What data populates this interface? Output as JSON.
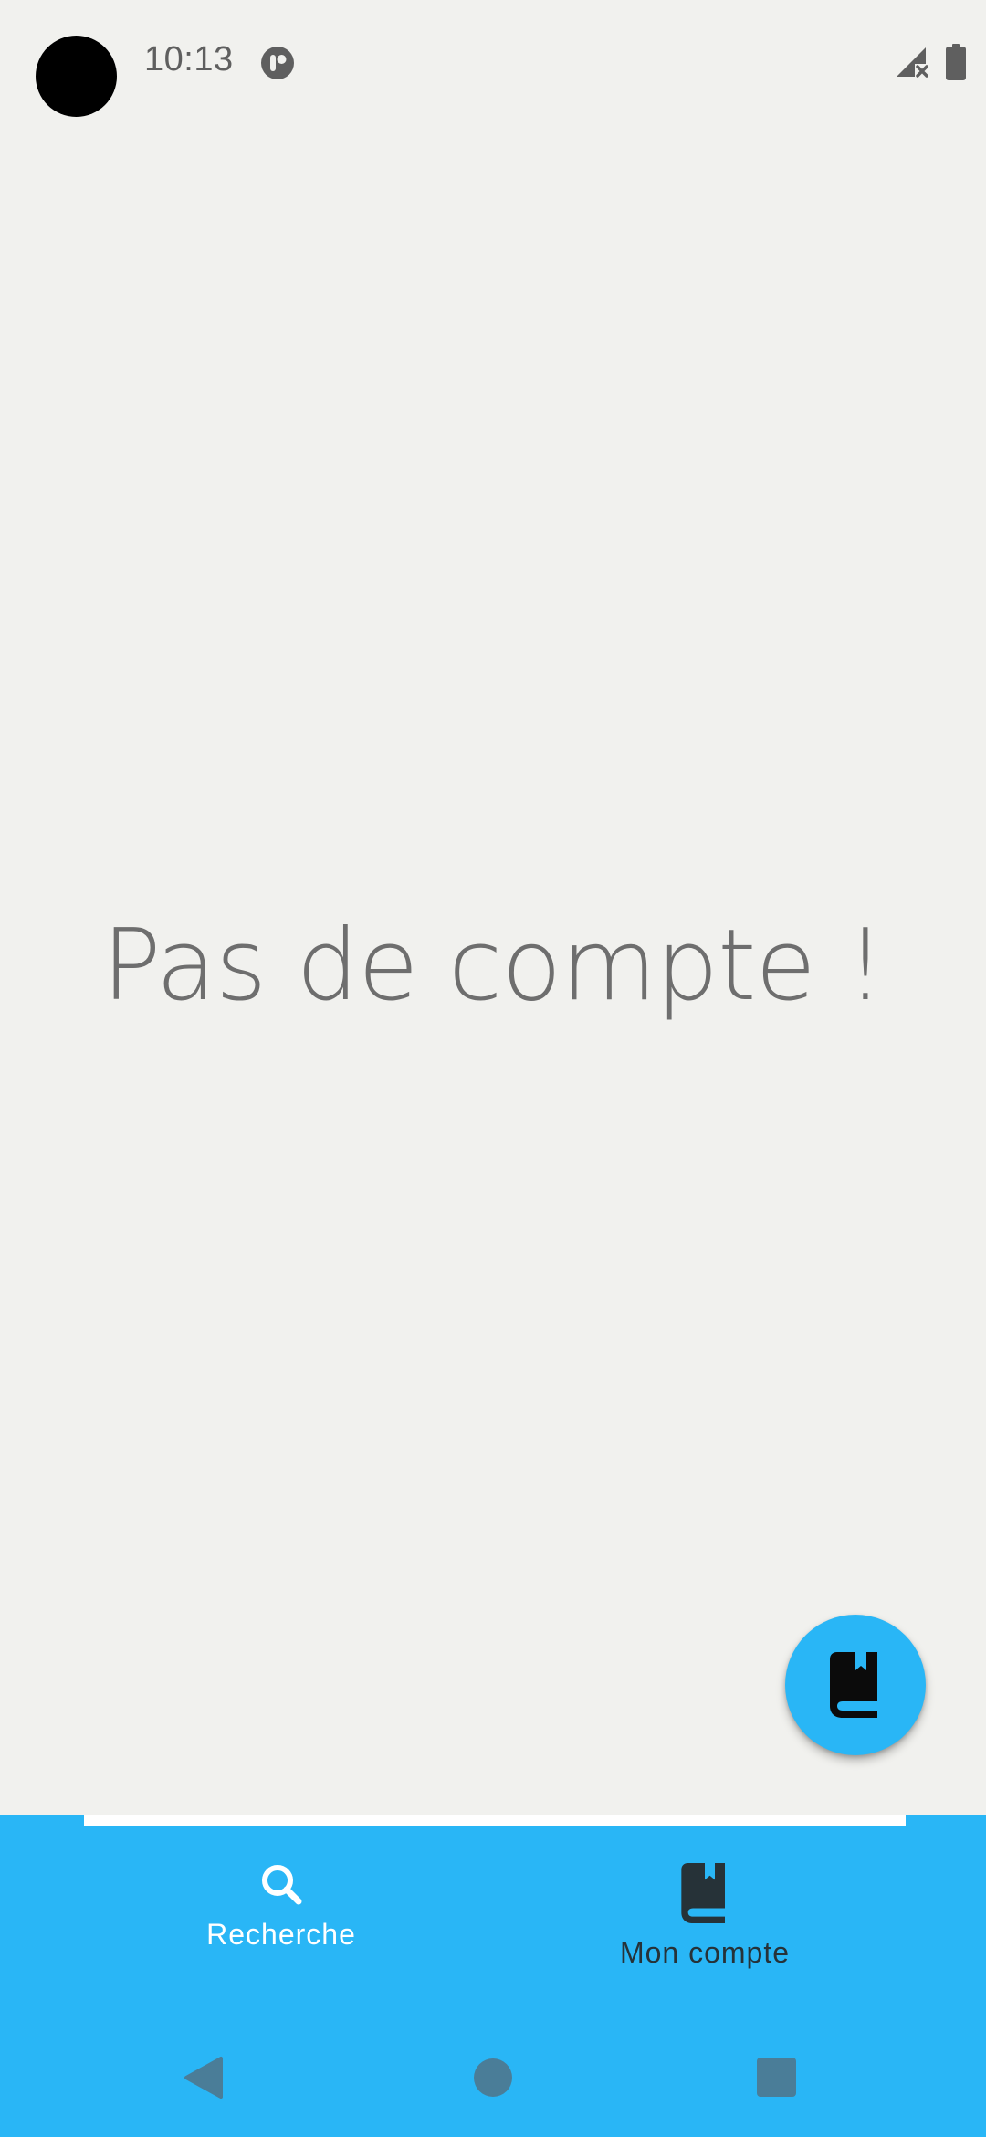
{
  "status_bar": {
    "time": "10:13",
    "icons": [
      "camera-cutout",
      "notification-app-icon",
      "signal-no-service-icon",
      "battery-icon"
    ]
  },
  "main": {
    "empty_message": "Pas de compte !"
  },
  "fab": {
    "icon": "book-icon"
  },
  "bottom_nav": {
    "items": [
      {
        "label": "Recherche",
        "icon": "search-icon",
        "selected": false
      },
      {
        "label": "Mon compte",
        "icon": "book-icon",
        "selected": true
      }
    ]
  },
  "system_nav": {
    "icons": [
      "back-icon",
      "home-icon",
      "recents-icon"
    ]
  },
  "colors": {
    "accent": "#29b6f6",
    "background": "#f1f1ee",
    "text_muted": "#6e6e6e",
    "nav_selected": "#263238",
    "nav_unselected": "#ffffff",
    "system_nav_icons": "#4a7d98"
  }
}
